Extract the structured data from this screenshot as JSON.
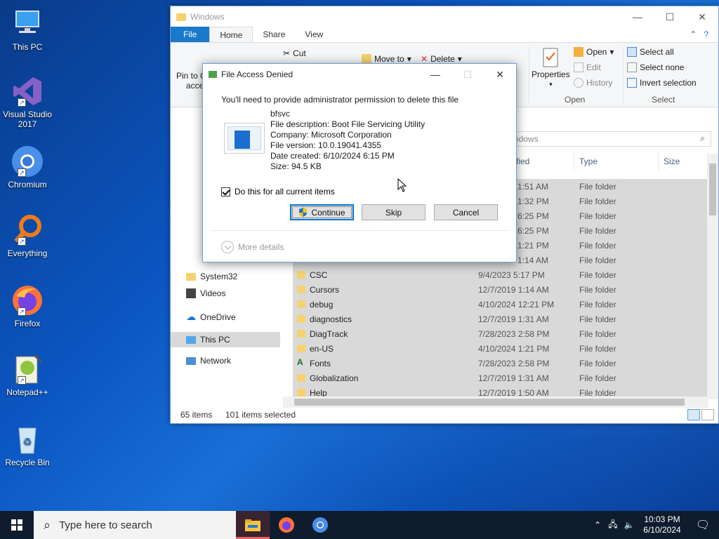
{
  "desktop": {
    "icons": [
      {
        "label": "This PC"
      },
      {
        "label": "Visual Studio 2017"
      },
      {
        "label": "Chromium"
      },
      {
        "label": "Everything"
      },
      {
        "label": "Firefox"
      },
      {
        "label": "Notepad++"
      },
      {
        "label": "Recycle Bin"
      }
    ]
  },
  "explorer": {
    "title": "Windows",
    "tabs": [
      "File",
      "Home",
      "Share",
      "View"
    ],
    "ribbon": {
      "pin_label": "Pin to Q",
      "pin_label2": "acce",
      "cut": "Cut",
      "move_to": "Move to",
      "delete": "Delete",
      "properties": "Properties",
      "open": "Open",
      "edit": "Edit",
      "history": "History",
      "open_group": "Open",
      "select_all": "Select all",
      "select_none": "Select none",
      "invert_selection": "Invert selection",
      "select_group": "Select"
    },
    "search_placeholder": "ndows",
    "columns": {
      "modified": "fied",
      "type": "Type",
      "size": "Size"
    },
    "nav": {
      "system32": "System32",
      "videos": "Videos",
      "onedrive": "OneDrive",
      "thispc": "This PC",
      "network": "Network"
    },
    "hidden_rows": [
      {
        "date": "1:51 AM",
        "type": "File folder"
      },
      {
        "date": "1:32 PM",
        "type": "File folder"
      },
      {
        "date": "6:25 PM",
        "type": "File folder"
      },
      {
        "date": "6:25 PM",
        "type": "File folder"
      },
      {
        "date": "1:21 PM",
        "type": "File folder"
      },
      {
        "date": "1:14 AM",
        "type": "File folder"
      }
    ],
    "rows": [
      {
        "name": "CSC",
        "date": "9/4/2023 5:17 PM",
        "type": "File folder"
      },
      {
        "name": "Cursors",
        "date": "12/7/2019 1:14 AM",
        "type": "File folder"
      },
      {
        "name": "debug",
        "date": "4/10/2024 12:21 PM",
        "type": "File folder"
      },
      {
        "name": "diagnostics",
        "date": "12/7/2019 1:31 AM",
        "type": "File folder"
      },
      {
        "name": "DiagTrack",
        "date": "7/28/2023 2:58 PM",
        "type": "File folder"
      },
      {
        "name": "en-US",
        "date": "4/10/2024 1:21 PM",
        "type": "File folder"
      },
      {
        "name": "Fonts",
        "date": "7/28/2023 2:58 PM",
        "type": "File folder"
      },
      {
        "name": "Globalization",
        "date": "12/7/2019 1:31 AM",
        "type": "File folder"
      },
      {
        "name": "Help",
        "date": "12/7/2019 1:50 AM",
        "type": "File folder"
      }
    ],
    "status": {
      "items": "65 items",
      "selected": "101 items selected"
    }
  },
  "dialog": {
    "title": "File Access Denied",
    "message": "You'll need to provide administrator permission to delete this file",
    "file_name": "bfsvc",
    "description": "File description: Boot File Servicing Utility",
    "company": "Company: Microsoft Corporation",
    "version": "File version: 10.0.19041.4355",
    "date_created": "Date created: 6/10/2024 6:15 PM",
    "size": "Size: 94.5 KB",
    "checkbox_label": "Do this for all current items",
    "checkbox_checked": true,
    "continue": "Continue",
    "skip": "Skip",
    "cancel": "Cancel",
    "more_details": "More details"
  },
  "taskbar": {
    "search_placeholder": "Type here to search",
    "time": "10:03 PM",
    "date": "6/10/2024"
  }
}
